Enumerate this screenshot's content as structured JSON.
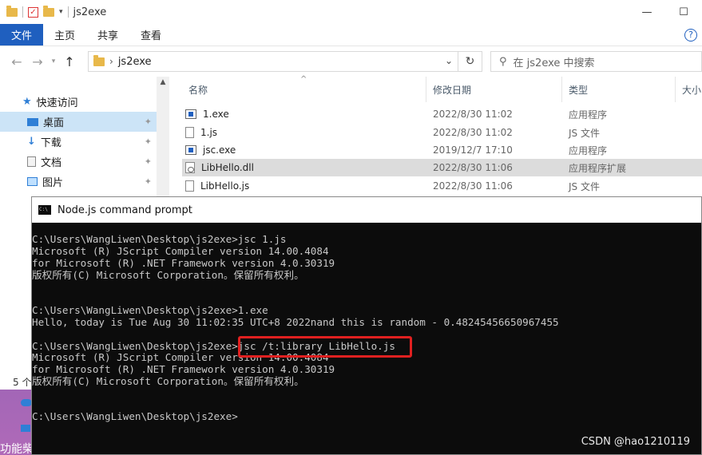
{
  "explorer": {
    "title": "js2exe",
    "ribbon_tabs": [
      "文件",
      "主页",
      "共享",
      "查看"
    ],
    "help": "?",
    "address": {
      "crumb": "js2exe"
    },
    "search_placeholder": "在 js2exe 中搜索",
    "nav": [
      {
        "label": "快速访问"
      },
      {
        "label": "桌面"
      },
      {
        "label": "下载"
      },
      {
        "label": "文档"
      },
      {
        "label": "图片"
      }
    ],
    "item_count": "5 个",
    "columns": [
      "名称",
      "修改日期",
      "类型",
      "大小"
    ],
    "files": [
      {
        "name": "1.exe",
        "date": "2022/8/30 11:02",
        "type": "应用程序",
        "icon": "exe-icon"
      },
      {
        "name": "1.js",
        "date": "2022/8/30 11:02",
        "type": "JS 文件",
        "icon": "js-file-icon"
      },
      {
        "name": "jsc.exe",
        "date": "2019/12/7 17:10",
        "type": "应用程序",
        "icon": "exe-icon"
      },
      {
        "name": "LibHello.dll",
        "date": "2022/8/30 11:06",
        "type": "应用程序扩展",
        "icon": "dll-icon"
      },
      {
        "name": "LibHello.js",
        "date": "2022/8/30 11:06",
        "type": "JS 文件",
        "icon": "js-file-icon"
      }
    ]
  },
  "console": {
    "title": "Node.js command prompt",
    "lines": [
      "C:\\Users\\WangLiwen\\Desktop\\js2exe>jsc 1.js",
      "Microsoft (R) JScript Compiler version 14.00.4084",
      "for Microsoft (R) .NET Framework version 4.0.30319",
      "版权所有(C) Microsoft Corporation。保留所有权利。",
      "",
      "",
      "C:\\Users\\WangLiwen\\Desktop\\js2exe>1.exe",
      "Hello, today is Tue Aug 30 11:02:35 UTC+8 2022nand this is random - 0.48245456650967455",
      "",
      "C:\\Users\\WangLiwen\\Desktop\\js2exe>jsc /t:library LibHello.js",
      "Microsoft (R) JScript Compiler version 14.00.4084",
      "for Microsoft (R) .NET Framework version 4.0.30319",
      "版权所有(C) Microsoft Corporation。保留所有权利。",
      "",
      "",
      "C:\\Users\\WangLiwen\\Desktop\\js2exe>"
    ]
  },
  "desktop_label": "功能柴",
  "watermark": "CSDN @hao1210119",
  "colors": {
    "accent": "#1f5fbf",
    "highlight": "#e02020",
    "console_bg": "#0c0c0c"
  }
}
